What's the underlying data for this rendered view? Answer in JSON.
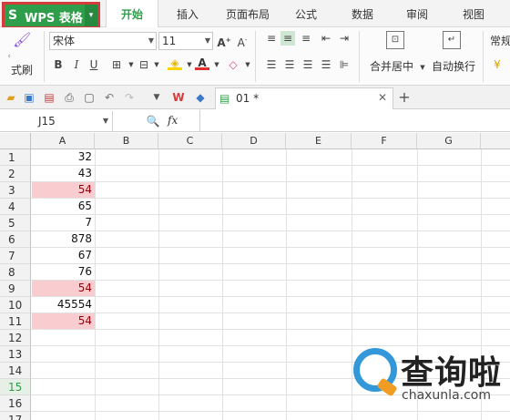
{
  "app": {
    "menu_button": "WPS 表格",
    "menu_tabs": [
      "开始",
      "插入",
      "页面布局",
      "公式",
      "数据",
      "审阅",
      "视图"
    ],
    "active_tab": "开始"
  },
  "ribbon": {
    "format_painter_label": "式刷",
    "font_name": "宋体",
    "font_size": "11",
    "merge_center_label": "合并居中",
    "wrap_text_label": "自动换行",
    "number_format": "常规",
    "accent_color": "#2f9e4a",
    "highlight_color": "#d63b3b"
  },
  "doc_tab": {
    "name": "01 *"
  },
  "formula_bar": {
    "cell_ref": "J15",
    "fx_label": "fx",
    "formula": ""
  },
  "sheet": {
    "columns": [
      "A",
      "B",
      "C",
      "D",
      "E",
      "F",
      "G"
    ],
    "rows": [
      "1",
      "2",
      "3",
      "4",
      "5",
      "6",
      "7",
      "8",
      "9",
      "10",
      "11",
      "12",
      "13",
      "14",
      "15",
      "16",
      "17"
    ],
    "active_row": "15",
    "col_a_values": [
      "32",
      "43",
      "54",
      "65",
      "7",
      "878",
      "67",
      "76",
      "54",
      "45554",
      "54"
    ],
    "duplicate_highlight_rows": [
      3,
      9,
      11
    ],
    "duplicate_fill_color": "#f9cccf"
  },
  "watermark": {
    "brand_cn": "查询啦",
    "brand_url": "chaxunla.com"
  }
}
